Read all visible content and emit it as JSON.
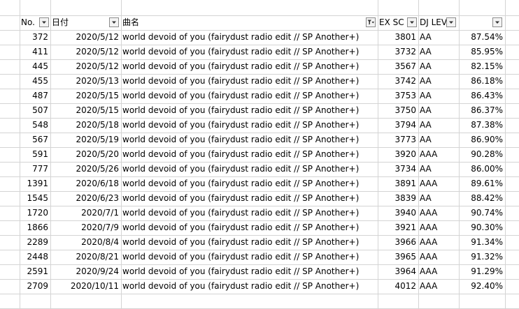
{
  "header": {
    "no": "No.",
    "date": "日付",
    "song": "曲名",
    "ex_score": "EX SC",
    "dj_level": "DJ LEV",
    "rate": ""
  },
  "filter": {
    "icon": "dropdown-arrow",
    "active_icon": "filter-funnel",
    "active_column": "song"
  },
  "rows": [
    {
      "no": "372",
      "date": "2020/5/12",
      "song": "world devoid of you (fairydust radio edit // SP Another+)",
      "ex": "3801",
      "level": "AA",
      "rate": "87.54%"
    },
    {
      "no": "411",
      "date": "2020/5/12",
      "song": "world devoid of you (fairydust radio edit // SP Another+)",
      "ex": "3732",
      "level": "AA",
      "rate": "85.95%"
    },
    {
      "no": "445",
      "date": "2020/5/12",
      "song": "world devoid of you (fairydust radio edit // SP Another+)",
      "ex": "3567",
      "level": "AA",
      "rate": "82.15%"
    },
    {
      "no": "455",
      "date": "2020/5/13",
      "song": "world devoid of you (fairydust radio edit // SP Another+)",
      "ex": "3742",
      "level": "AA",
      "rate": "86.18%"
    },
    {
      "no": "487",
      "date": "2020/5/15",
      "song": "world devoid of you (fairydust radio edit // SP Another+)",
      "ex": "3753",
      "level": "AA",
      "rate": "86.43%"
    },
    {
      "no": "507",
      "date": "2020/5/15",
      "song": "world devoid of you (fairydust radio edit // SP Another+)",
      "ex": "3750",
      "level": "AA",
      "rate": "86.37%"
    },
    {
      "no": "548",
      "date": "2020/5/18",
      "song": "world devoid of you (fairydust radio edit // SP Another+)",
      "ex": "3794",
      "level": "AA",
      "rate": "87.38%"
    },
    {
      "no": "567",
      "date": "2020/5/19",
      "song": "world devoid of you (fairydust radio edit // SP Another+)",
      "ex": "3773",
      "level": "AA",
      "rate": "86.90%"
    },
    {
      "no": "591",
      "date": "2020/5/20",
      "song": "world devoid of you (fairydust radio edit // SP Another+)",
      "ex": "3920",
      "level": "AAA",
      "rate": "90.28%"
    },
    {
      "no": "777",
      "date": "2020/5/26",
      "song": "world devoid of you (fairydust radio edit // SP Another+)",
      "ex": "3734",
      "level": "AA",
      "rate": "86.00%"
    },
    {
      "no": "1391",
      "date": "2020/6/18",
      "song": "world devoid of you (fairydust radio edit // SP Another+)",
      "ex": "3891",
      "level": "AAA",
      "rate": "89.61%"
    },
    {
      "no": "1545",
      "date": "2020/6/23",
      "song": "world devoid of you (fairydust radio edit // SP Another+)",
      "ex": "3839",
      "level": "AA",
      "rate": "88.42%"
    },
    {
      "no": "1720",
      "date": "2020/7/1",
      "song": "world devoid of you (fairydust radio edit // SP Another+)",
      "ex": "3940",
      "level": "AAA",
      "rate": "90.74%"
    },
    {
      "no": "1866",
      "date": "2020/7/9",
      "song": "world devoid of you (fairydust radio edit // SP Another+)",
      "ex": "3921",
      "level": "AAA",
      "rate": "90.30%"
    },
    {
      "no": "2289",
      "date": "2020/8/4",
      "song": "world devoid of you (fairydust radio edit // SP Another+)",
      "ex": "3966",
      "level": "AAA",
      "rate": "91.34%"
    },
    {
      "no": "2448",
      "date": "2020/8/21",
      "song": "world devoid of you (fairydust radio edit // SP Another+)",
      "ex": "3965",
      "level": "AAA",
      "rate": "91.32%"
    },
    {
      "no": "2591",
      "date": "2020/9/24",
      "song": "world devoid of you (fairydust radio edit // SP Another+)",
      "ex": "3964",
      "level": "AAA",
      "rate": "91.29%"
    },
    {
      "no": "2709",
      "date": "2020/10/11",
      "song": "world devoid of you (fairydust radio edit // SP Another+)",
      "ex": "4012",
      "level": "AAA",
      "rate": "92.40%"
    }
  ]
}
